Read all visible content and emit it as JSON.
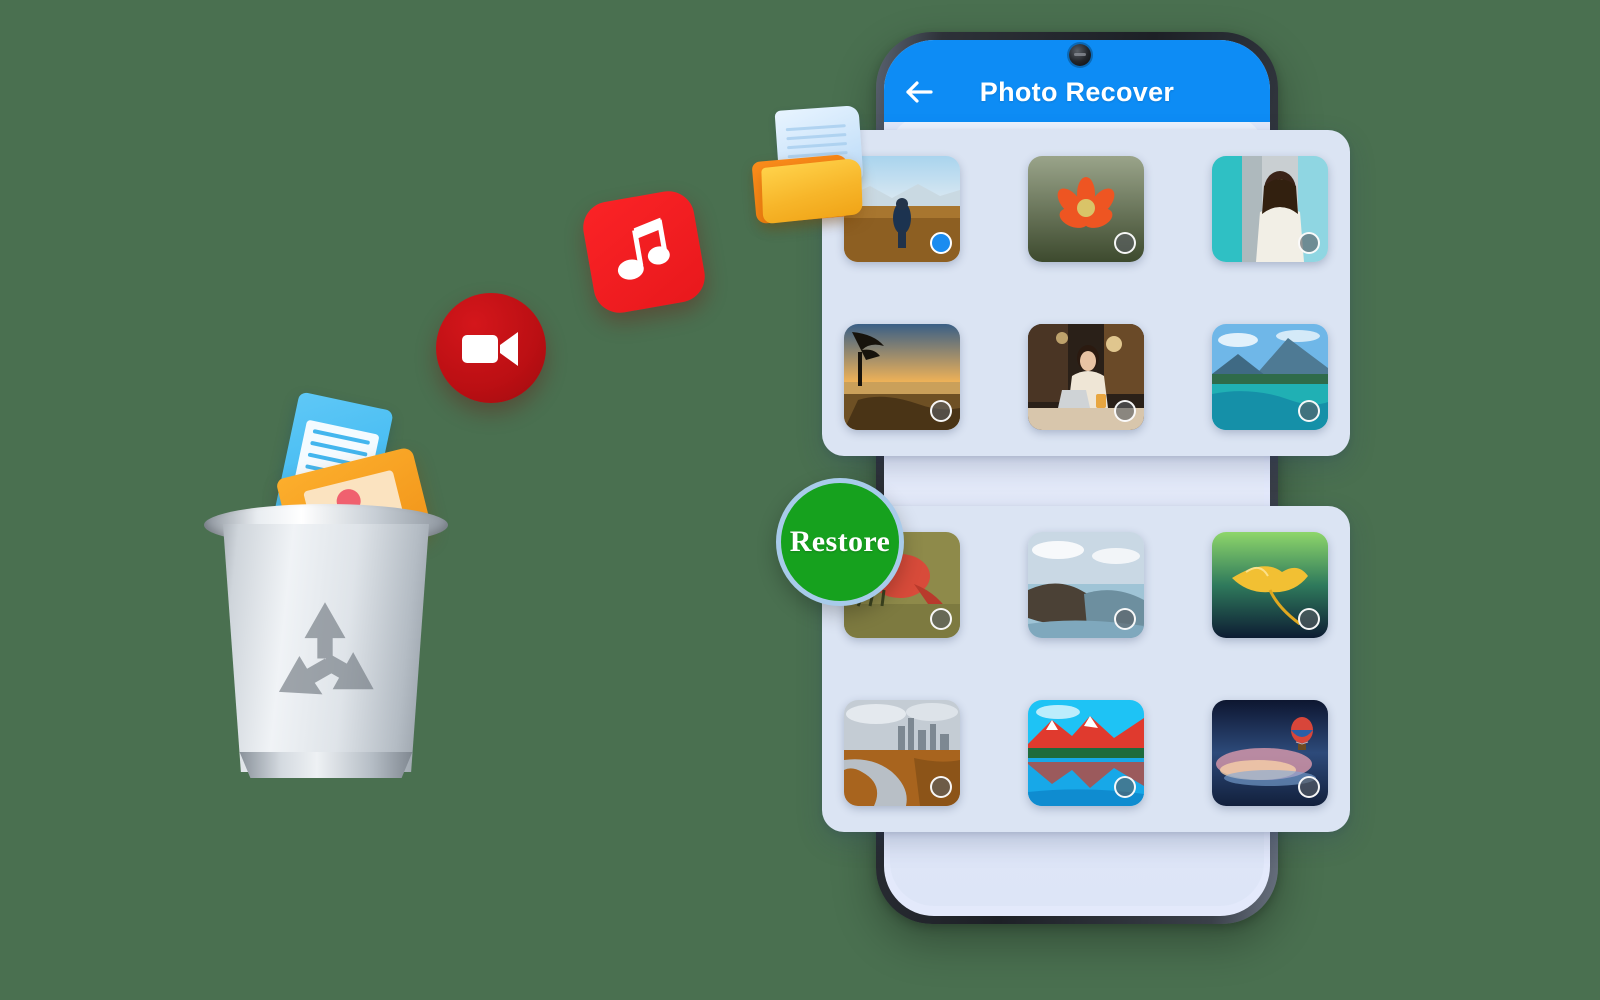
{
  "app": {
    "header": {
      "title": "Photo Recover",
      "back_icon": "arrow-left-icon",
      "bg_color": "#0d8cf5",
      "title_color": "#ffffff"
    },
    "device": {
      "frame_color": "#22262c",
      "screen_color": "#e3e9fb",
      "camera": "front-camera-punch-hole"
    }
  },
  "restore": {
    "label": "Restore",
    "bg_color": "#16a11e",
    "ring_color": "#a8cbea",
    "text_color": "#ffffff"
  },
  "selection": {
    "selected_color": "#1a8cf0",
    "unselected_color": "rgba(90,95,100,0.62)",
    "selected_count": 1
  },
  "cards": [
    {
      "id": "photo-card-1",
      "bg_color": "#dbe4f3",
      "tiles": [
        {
          "name": "hiker-in-field",
          "selected": true,
          "art": "field"
        },
        {
          "name": "orange-flower",
          "selected": false,
          "art": "flower"
        },
        {
          "name": "woman-portrait",
          "selected": false,
          "art": "portrait"
        },
        {
          "name": "lake-sunset-tree",
          "selected": false,
          "art": "sunset"
        },
        {
          "name": "woman-at-laptop",
          "selected": false,
          "art": "cafe"
        },
        {
          "name": "mountain-lake",
          "selected": false,
          "art": "mountain"
        }
      ]
    },
    {
      "id": "photo-card-2",
      "bg_color": "#dbe4f3",
      "tiles": [
        {
          "name": "red-bird-branch",
          "selected": false,
          "art": "bird"
        },
        {
          "name": "coastal-cliff",
          "selected": false,
          "art": "cliff"
        },
        {
          "name": "yellow-leaf",
          "selected": false,
          "art": "leaf"
        },
        {
          "name": "city-skyline-road",
          "selected": false,
          "art": "city"
        },
        {
          "name": "mountain-reflection",
          "selected": false,
          "art": "reflection"
        },
        {
          "name": "hot-air-balloon-dusk",
          "selected": false,
          "art": "balloon"
        }
      ]
    }
  ],
  "floating_icons": {
    "music": {
      "name": "music-note-icon",
      "bg_color": "#ee1b1f",
      "glyph_color": "#ffffff"
    },
    "video": {
      "name": "video-camera-icon",
      "bg_color": "#bb0f13",
      "glyph_color": "#ffffff"
    },
    "folder_over_phone": {
      "name": "open-folder-icon",
      "bg_color": "#f7b62a"
    }
  },
  "trash": {
    "name": "recycle-bin",
    "symbol": "recycle-symbol",
    "body_color": "#d6dbe1",
    "items": [
      {
        "name": "document-file-icon",
        "color": "#36b4ee"
      },
      {
        "name": "contacts-folder-icon",
        "color": "#f2951a"
      }
    ]
  },
  "background": {
    "color": "#4a7050"
  }
}
